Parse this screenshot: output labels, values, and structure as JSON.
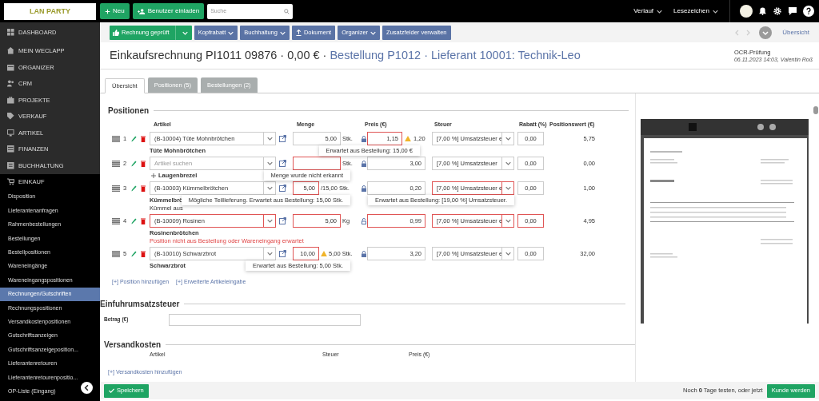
{
  "header": {
    "logo": "LAN PARTY",
    "new_button": "Neu",
    "invite_button": "Benutzer einladen",
    "search": {
      "placeholder": "Suche"
    },
    "menus": [
      "Verlauf",
      "Lesezeichen"
    ]
  },
  "sidebar": {
    "items": [
      {
        "label": "DASHBOARD",
        "expanded": false
      },
      {
        "label": "MEIN WECLAPP",
        "expanded": false
      },
      {
        "label": "ORGANIZER",
        "expanded": false
      },
      {
        "label": "CRM",
        "expanded": false
      },
      {
        "label": "PROJEKTE",
        "expanded": false
      },
      {
        "label": "VERKAUF",
        "expanded": false
      },
      {
        "label": "ARTIKEL",
        "expanded": false
      },
      {
        "label": "FINANZEN",
        "expanded": false
      },
      {
        "label": "BUCHHALTUNG",
        "expanded": false
      },
      {
        "label": "EINKAUF",
        "expanded": true,
        "children": [
          {
            "label": "Disposition",
            "selected": false
          },
          {
            "label": "Lieferantenanfragen",
            "selected": false
          },
          {
            "label": "Rahmenbestellungen",
            "selected": false
          },
          {
            "label": "Bestellungen",
            "selected": false
          },
          {
            "label": "Bestellpositionen",
            "selected": false
          },
          {
            "label": "Wareneingänge",
            "selected": false
          },
          {
            "label": "Wareneingangspositionen",
            "selected": false
          },
          {
            "label": "Rechnungen/Gutschriften",
            "selected": true
          },
          {
            "label": "Rechnungspositionen",
            "selected": false
          },
          {
            "label": "Versandkostenpositionen",
            "selected": false
          },
          {
            "label": "Gutschriftsanzeigen",
            "selected": false
          },
          {
            "label": "Gutschriftsanzeigeposition...",
            "selected": false
          },
          {
            "label": "Lieferantenretouren",
            "selected": false
          },
          {
            "label": "Lieferantenretourenpositio...",
            "selected": false
          },
          {
            "label": "OP-Liste (Eingang)",
            "selected": false
          }
        ]
      }
    ]
  },
  "toolbar": {
    "buttons": [
      {
        "label": "Rechnung geprüft",
        "kind": "split"
      },
      {
        "label": "Kopfrabatt",
        "kind": "dropdown"
      },
      {
        "label": "Buchhaltung",
        "kind": "dropdown"
      },
      {
        "label": "Dokument",
        "kind": "upload"
      },
      {
        "label": "Organizer",
        "kind": "dropdown"
      },
      {
        "label": "Zusatzfelder verwalten",
        "kind": "plain"
      }
    ],
    "overview_link": "Übersicht"
  },
  "title": {
    "main": "Einkaufsrechnung PI1011 09876 · 0,00 € ·",
    "link": "Bestellung P1012 · Lieferant 10001: Technik-Leo"
  },
  "ocr": {
    "label": "OCR-Prüfung",
    "meta": "06.11.2023 14:03, Valentin Roß"
  },
  "tabs": [
    {
      "label": "Übersicht",
      "selected": true
    },
    {
      "label": "Positionen (5)",
      "selected": false
    },
    {
      "label": "Bestellungen (2)",
      "selected": false
    }
  ],
  "positions": {
    "title": "Positionen",
    "columns": [
      "Artikel",
      "Menge",
      "Preis (€)",
      "Steuer",
      "Rabatt (%)",
      "Positionswert (€)"
    ],
    "rows": [
      {
        "number": "1",
        "article": {
          "value": "(B-10004) Tüte Mohnbrötchen",
          "error": false
        },
        "lines": [
          {
            "kind": "name",
            "text": "Tüte Mohnbrötchen"
          }
        ],
        "quantity": {
          "value": "5,00",
          "error": false,
          "unit": "Stk."
        },
        "price": {
          "value": "1,15",
          "error": true,
          "locked": true,
          "warning": "1,20",
          "tooltip": "Erwartet aus Bestellung: 15,00 €"
        },
        "tax": {
          "value": "[7,00 %] Umsatzsteuer e",
          "error": false
        },
        "discount": {
          "value": "0,00",
          "error": false
        },
        "total": "5,75"
      },
      {
        "number": "2",
        "article": {
          "placeholder": "Artikel suchen",
          "error": false
        },
        "lines": [
          {
            "kind": "new",
            "text": "Laugenbrezel"
          }
        ],
        "quantity": {
          "error": true,
          "unit": "Stk.",
          "tooltip": "Menge wurde nicht erkannt"
        },
        "price": {
          "value": "3,00",
          "error": false,
          "locked": true
        },
        "tax": {
          "value": "[7,00 %] Umsatzsteuer",
          "error": false
        },
        "discount": {
          "value": "0,00",
          "error": false
        },
        "total": "0,00"
      },
      {
        "number": "3",
        "article": {
          "value": "(B-10003) Kümmelbrötchen",
          "error": false
        },
        "lines": [
          {
            "kind": "name",
            "text": "Kümmelbrö"
          },
          {
            "kind": "desc",
            "text": "Kümmel aus"
          }
        ],
        "quantity": {
          "value": "5,00",
          "error": true,
          "unit": "/15,00 Stk.",
          "tooltip": "Mögliche Teillieferung. Erwartet aus Bestellung: 15,00 Stk."
        },
        "price": {
          "value": "0,20",
          "error": false,
          "locked": true
        },
        "tax": {
          "value": "[7,00 %] Umsatzsteuer e",
          "error": true,
          "tooltip": "Erwartet aus Bestellung: [19,00 %] Umsatzsteuer."
        },
        "discount": {
          "value": "0,00",
          "error": false
        },
        "total": "1,00"
      },
      {
        "number": "4",
        "article": {
          "value": "(B-10009) Rosinen",
          "error": true
        },
        "lines": [
          {
            "kind": "name",
            "text": "Rosinenbrötchen"
          },
          {
            "kind": "error",
            "text": "Position nicht aus Bestellung oder Wareneingang erwartet"
          }
        ],
        "quantity": {
          "value": "5,00",
          "error": true,
          "unit": "Kg"
        },
        "price": {
          "value": "0,99",
          "error": true,
          "locked": false
        },
        "tax": {
          "value": "[7,00 %] Umsatzsteuer e",
          "error": true
        },
        "discount": {
          "value": "0,00",
          "error": true
        },
        "total": "4,95"
      },
      {
        "number": "5",
        "article": {
          "value": "(B-10010) Schwarzbrot",
          "error": false
        },
        "lines": [
          {
            "kind": "name",
            "text": "Schwarzbrot"
          }
        ],
        "quantity": {
          "value": "10,00",
          "error": true,
          "warning": "5,00 Stk.",
          "tooltip": "Erwartet aus Bestellung: 5,00 Stk."
        },
        "price": {
          "value": "3,20",
          "error": false,
          "locked": true
        },
        "tax": {
          "value": "[7,00 %] Umsatzsteuer e",
          "error": false
        },
        "discount": {
          "value": "0,00",
          "error": false
        },
        "total": "32,00"
      }
    ],
    "links": [
      "[+] Position hinzufügen",
      "[+] Erweiterte Artikeleingabe"
    ]
  },
  "import_tax": {
    "title": "Einfuhrumsatzsteuer",
    "field_label": "Betrag (€)"
  },
  "shipping": {
    "title": "Versandkosten",
    "columns": [
      "Artikel",
      "Steuer",
      "Preis (€)"
    ],
    "link": "[+] Versandkosten hinzufügen"
  },
  "footer": {
    "save_button": "Speichern",
    "trial_text": "Noch **0** Tage testen, oder jetzt",
    "cta_button": "Kunde werden"
  }
}
